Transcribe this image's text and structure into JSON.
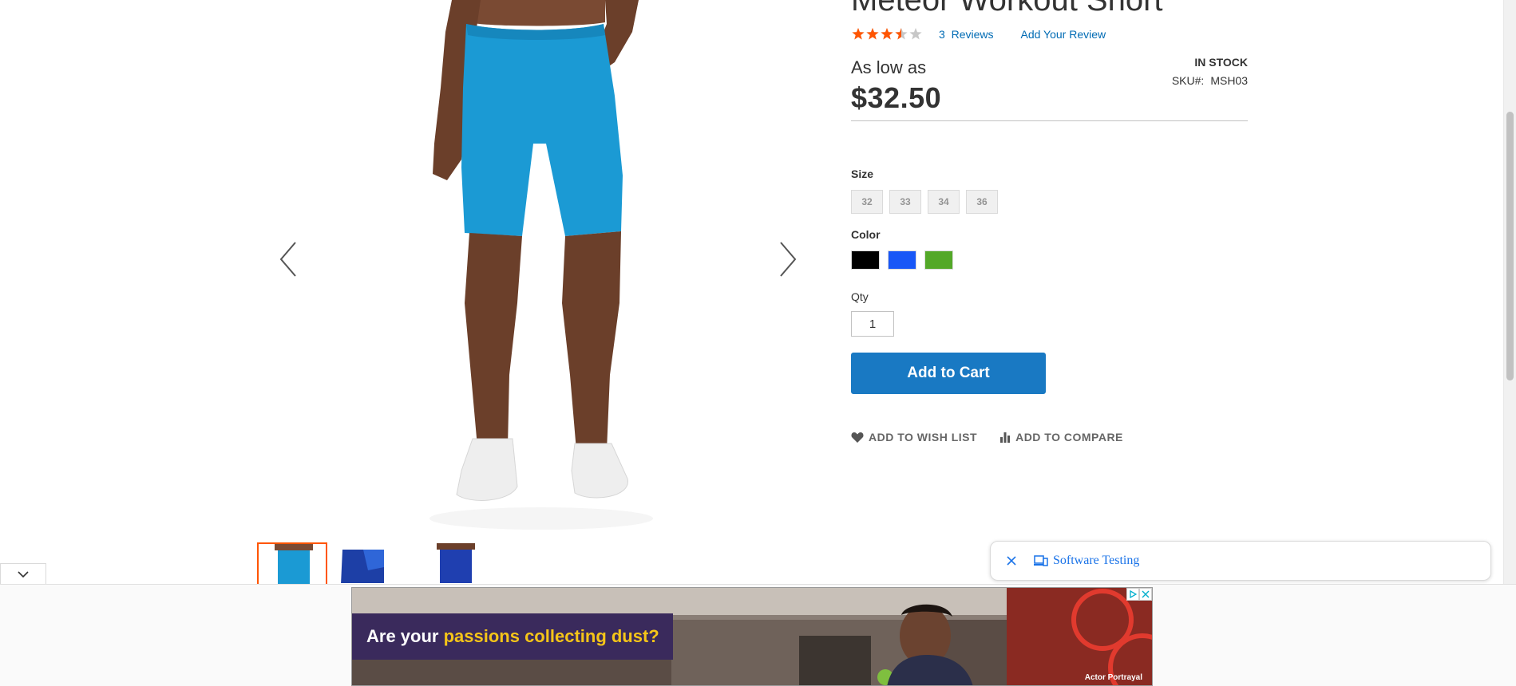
{
  "product": {
    "title": "Meteor Workout Short",
    "rating_percent": 70,
    "reviews_count": "3",
    "reviews_label": "Reviews",
    "add_review_label": "Add Your Review",
    "price_prefix": "As low as",
    "price": "$32.50",
    "stock": "IN STOCK",
    "sku_label": "SKU#:",
    "sku": "MSH03"
  },
  "options": {
    "size_label": "Size",
    "sizes": [
      "32",
      "33",
      "34",
      "36"
    ],
    "color_label": "Color",
    "colors": [
      {
        "name": "Black",
        "hex": "#000000"
      },
      {
        "name": "Blue",
        "hex": "#1857f7"
      },
      {
        "name": "Green",
        "hex": "#53a828"
      }
    ],
    "qty_label": "Qty",
    "qty_value": "1"
  },
  "actions": {
    "add_to_cart": "Add to Cart",
    "wishlist": "ADD TO WISH LIST",
    "compare": "ADD TO COMPARE"
  },
  "notification": {
    "text": "Software Testing"
  },
  "ad": {
    "headline_prefix": "Are your ",
    "headline_highlight": "passions collecting dust?",
    "disclaimer": "Actor Portrayal"
  },
  "colors": {
    "accent": "#1979c3",
    "star": "#ff5501",
    "link": "#006bb4"
  }
}
